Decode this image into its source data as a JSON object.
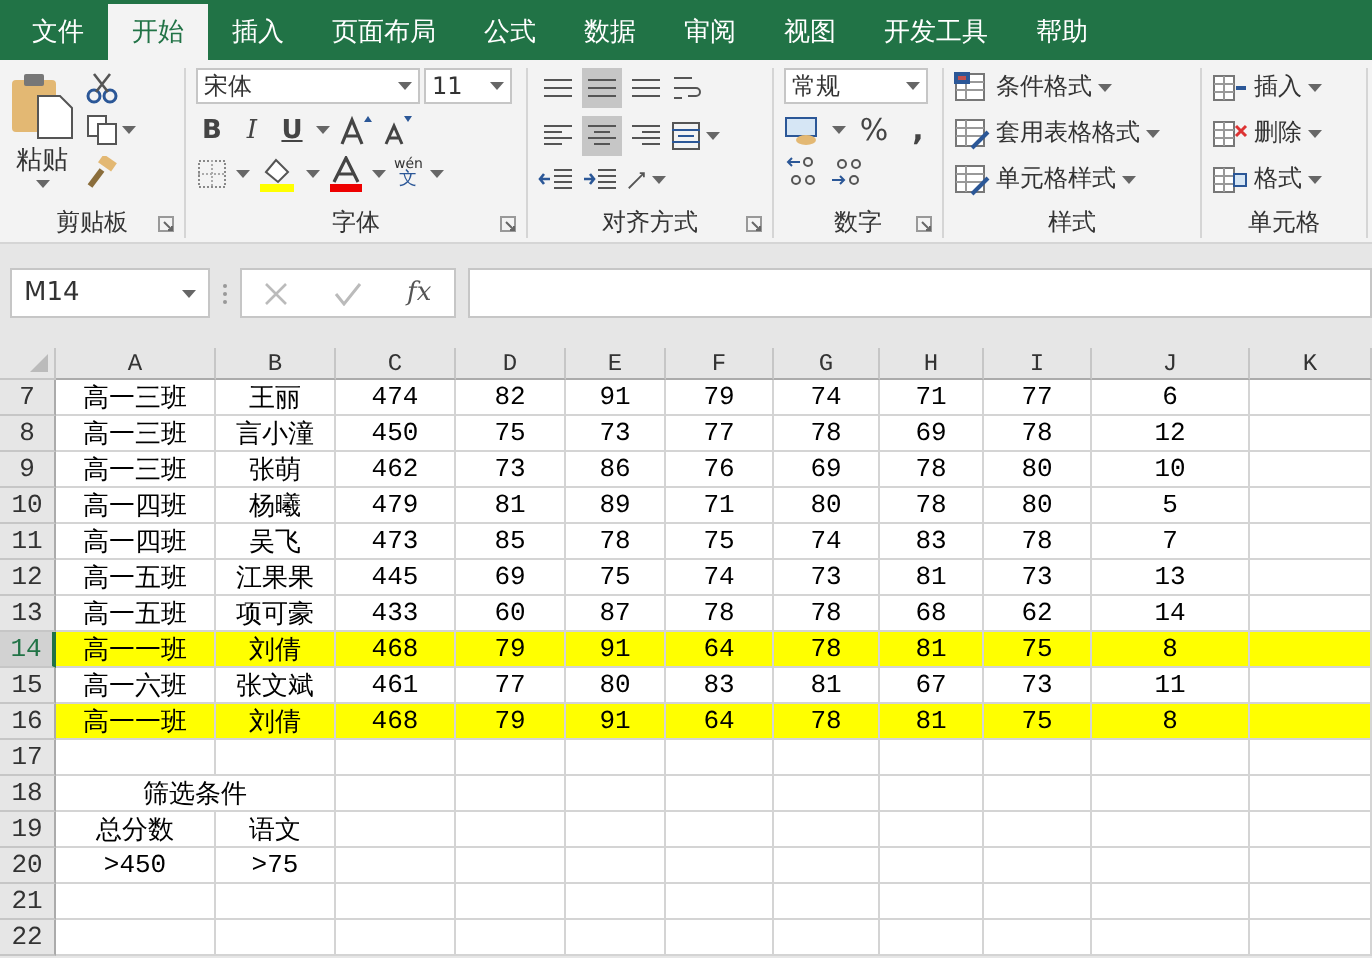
{
  "tabs": [
    {
      "label": "文件",
      "selected": false
    },
    {
      "label": "开始",
      "selected": true
    },
    {
      "label": "插入",
      "selected": false
    },
    {
      "label": "页面布局",
      "selected": false
    },
    {
      "label": "公式",
      "selected": false
    },
    {
      "label": "数据",
      "selected": false
    },
    {
      "label": "审阅",
      "selected": false
    },
    {
      "label": "视图",
      "selected": false
    },
    {
      "label": "开发工具",
      "selected": false
    },
    {
      "label": "帮助",
      "selected": false
    }
  ],
  "ribbon": {
    "groups": [
      {
        "kind": "clipboard",
        "label": "剪贴板",
        "launcher": true,
        "paste_label": "粘贴"
      },
      {
        "kind": "font",
        "label": "字体",
        "launcher": true,
        "font_name": "宋体",
        "font_size": "11",
        "bold": "B",
        "italic": "I",
        "underline": "U",
        "phonetic_top": "wén",
        "phonetic_bottom": "文"
      },
      {
        "kind": "alignment",
        "label": "对齐方式",
        "launcher": true,
        "vertical": [
          {
            "selected": false
          },
          {
            "selected": true
          },
          {
            "selected": false
          }
        ],
        "horizontal": [
          {
            "selected": false
          },
          {
            "selected": true
          },
          {
            "selected": false
          }
        ]
      },
      {
        "kind": "number",
        "label": "数字",
        "launcher": true,
        "format": "常规",
        "percent": "%",
        "comma": ","
      },
      {
        "kind": "styles",
        "label": "样式",
        "launcher": false,
        "buttons": [
          "条件格式",
          "套用表格格式",
          "单元格样式"
        ]
      },
      {
        "kind": "cells",
        "label": "单元格",
        "launcher": false,
        "buttons": [
          "插入",
          "删除",
          "格式"
        ]
      }
    ]
  },
  "formula_bar": {
    "name_box": "M14",
    "function_label": "fx"
  },
  "sheet": {
    "columns": [
      "A",
      "B",
      "C",
      "D",
      "E",
      "F",
      "G",
      "H",
      "I",
      "J",
      "K"
    ],
    "rows": [
      {
        "number": "7",
        "kind": "normal",
        "highlighted": false,
        "selected": false,
        "cells": [
          "高一三班",
          "王丽",
          "474",
          "82",
          "91",
          "79",
          "74",
          "71",
          "77",
          "6"
        ]
      },
      {
        "number": "8",
        "kind": "normal",
        "highlighted": false,
        "selected": false,
        "cells": [
          "高一三班",
          "言小潼",
          "450",
          "75",
          "73",
          "77",
          "78",
          "69",
          "78",
          "12"
        ]
      },
      {
        "number": "9",
        "kind": "normal",
        "highlighted": false,
        "selected": false,
        "cells": [
          "高一三班",
          "张萌",
          "462",
          "73",
          "86",
          "76",
          "69",
          "78",
          "80",
          "10"
        ]
      },
      {
        "number": "10",
        "kind": "normal",
        "highlighted": false,
        "selected": false,
        "cells": [
          "高一四班",
          "杨曦",
          "479",
          "81",
          "89",
          "71",
          "80",
          "78",
          "80",
          "5"
        ]
      },
      {
        "number": "11",
        "kind": "normal",
        "highlighted": false,
        "selected": false,
        "cells": [
          "高一四班",
          "吴飞",
          "473",
          "85",
          "78",
          "75",
          "74",
          "83",
          "78",
          "7"
        ]
      },
      {
        "number": "12",
        "kind": "normal",
        "highlighted": false,
        "selected": false,
        "cells": [
          "高一五班",
          "江果果",
          "445",
          "69",
          "75",
          "74",
          "73",
          "81",
          "73",
          "13"
        ]
      },
      {
        "number": "13",
        "kind": "normal",
        "highlighted": false,
        "selected": false,
        "cells": [
          "高一五班",
          "项可豪",
          "433",
          "60",
          "87",
          "78",
          "78",
          "68",
          "62",
          "14"
        ]
      },
      {
        "number": "14",
        "kind": "normal",
        "highlighted": true,
        "selected": true,
        "cells": [
          "高一一班",
          "刘倩",
          "468",
          "79",
          "91",
          "64",
          "78",
          "81",
          "75",
          "8"
        ]
      },
      {
        "number": "15",
        "kind": "normal",
        "highlighted": false,
        "selected": false,
        "cells": [
          "高一六班",
          "张文斌",
          "461",
          "77",
          "80",
          "83",
          "81",
          "67",
          "73",
          "11"
        ]
      },
      {
        "number": "16",
        "kind": "normal",
        "highlighted": true,
        "selected": false,
        "cells": [
          "高一一班",
          "刘倩",
          "468",
          "79",
          "91",
          "64",
          "78",
          "81",
          "75",
          "8"
        ]
      },
      {
        "number": "17",
        "kind": "normal",
        "highlighted": false,
        "selected": false,
        "cells": []
      },
      {
        "number": "18",
        "kind": "merged",
        "highlighted": false,
        "selected": false,
        "cells": [
          "筛选条件"
        ]
      },
      {
        "number": "19",
        "kind": "normal",
        "highlighted": false,
        "selected": false,
        "cells": [
          "总分数",
          "语文"
        ]
      },
      {
        "number": "20",
        "kind": "normal",
        "highlighted": false,
        "selected": false,
        "cells": [
          ">450",
          ">75"
        ]
      },
      {
        "number": "21",
        "kind": "normal",
        "highlighted": false,
        "selected": false,
        "cells": []
      },
      {
        "number": "22",
        "kind": "normal",
        "highlighted": false,
        "selected": false,
        "cells": []
      }
    ]
  }
}
